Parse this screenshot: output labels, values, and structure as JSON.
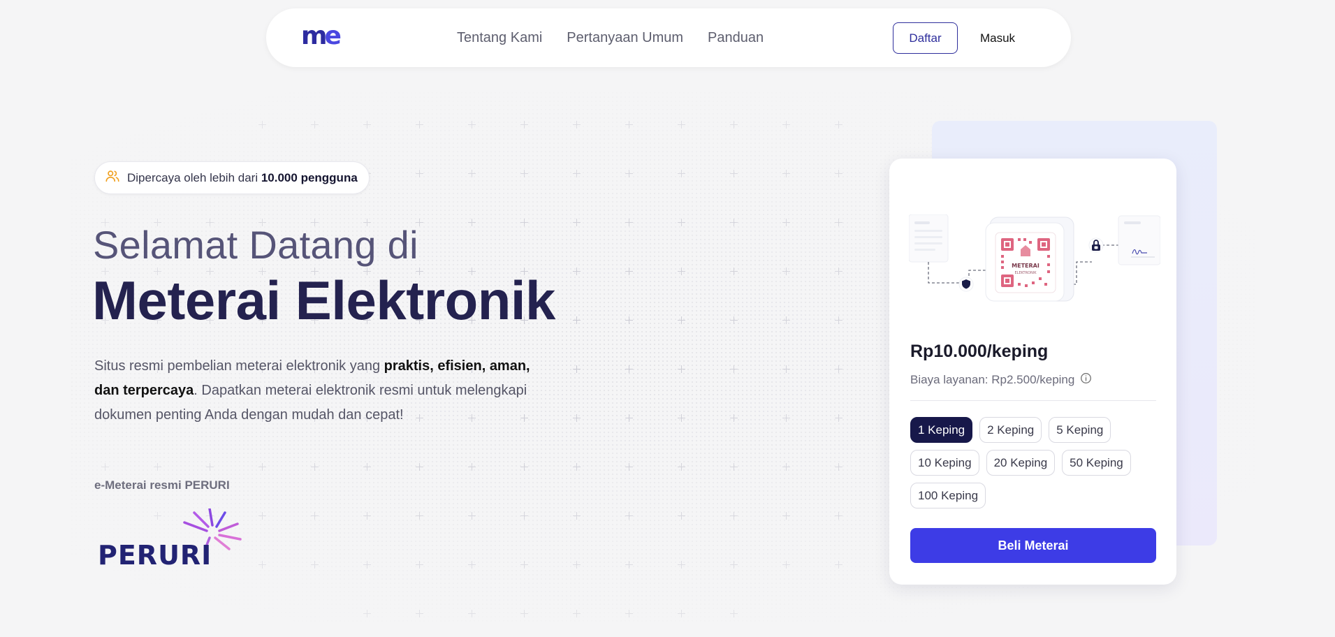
{
  "brand": {
    "logo_m": "m",
    "logo_e": "e",
    "primary_color": "#3d3ce6",
    "navy_color": "#24224f"
  },
  "nav": {
    "links": [
      "Tentang Kami",
      "Pertanyaan Umum",
      "Panduan"
    ],
    "register_label": "Daftar",
    "login_label": "Masuk"
  },
  "hero": {
    "badge_text": "Dipercaya oleh lebih dari ",
    "badge_bold": "10.000 pengguna",
    "subtitle": "Selamat Datang di",
    "title": "Meterai Elektronik",
    "desc_1": "Situs resmi pembelian meterai elektronik yang ",
    "desc_bold_1": "praktis, efisien, aman,",
    "desc_bold_2": "dan terpercaya",
    "desc_2": ". Dapatkan meterai elektronik resmi untuk melengkapi dokumen penting Anda dengan mudah dan cepat!",
    "partner_label": "e-Meterai resmi PERURI",
    "partner_logo_text": "PERURI"
  },
  "card": {
    "stamp_text_1": "METERAI",
    "stamp_text_2": "ELEKTRONIK",
    "price": "Rp10.000/keping",
    "fee": "Biaya layanan: Rp2.500/keping",
    "quantities": [
      "1 Keping",
      "2 Keping",
      "5 Keping",
      "10 Keping",
      "20 Keping",
      "50 Keping",
      "100 Keping"
    ],
    "selected_quantity": "1 Keping",
    "buy_label": "Beli Meterai"
  }
}
